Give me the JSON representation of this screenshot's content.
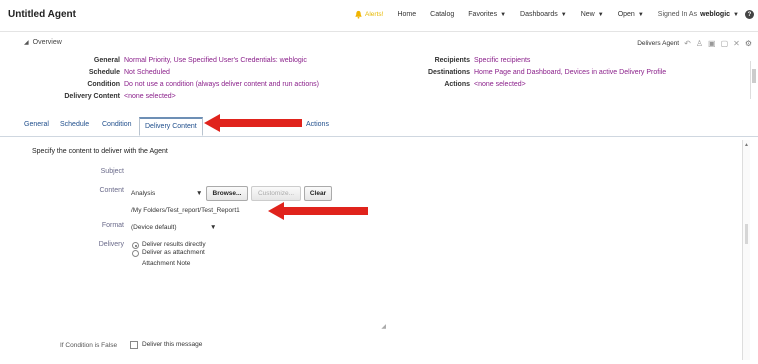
{
  "header": {
    "title": "Untitled Agent",
    "alerts_label": "Alerts!",
    "nav": [
      "Home",
      "Catalog",
      "Favorites",
      "Dashboards",
      "New",
      "Open"
    ],
    "signed_in_label": "Signed In As",
    "user": "weblogic"
  },
  "overview": {
    "heading": "Overview",
    "agent_label": "Delivers Agent",
    "left": [
      {
        "label": "General",
        "value": "Normal Priority, Use Specified User's Credentials: weblogic"
      },
      {
        "label": "Schedule",
        "value": "Not Scheduled"
      },
      {
        "label": "Condition",
        "value": "Do not use a condition (always deliver content and run actions)"
      },
      {
        "label": "Delivery Content",
        "value": "<none selected>"
      }
    ],
    "right": [
      {
        "label": "Recipients",
        "value": "Specific recipients"
      },
      {
        "label": "Destinations",
        "value": "Home Page and Dashboard, Devices in active Delivery Profile"
      },
      {
        "label": "Actions",
        "value": "<none selected>"
      }
    ]
  },
  "tabs": [
    "General",
    "Schedule",
    "Condition",
    "Delivery Content",
    "Actions"
  ],
  "active_tab": "Delivery Content",
  "panel": {
    "description": "Specify the content to deliver with the Agent",
    "subject_label": "Subject",
    "content_label": "Content",
    "content_value": "Analysis",
    "browse_label": "Browse...",
    "customize_label": "Customize...",
    "clear_label": "Clear",
    "path": "/My Folders/Test_report/Test_Report1",
    "format_label": "Format",
    "format_value": "(Device default)",
    "delivery_label": "Delivery",
    "delivery_options": [
      "Deliver results directly",
      "Deliver as attachment"
    ],
    "attachment_note": "Attachment Note",
    "if_false_label": "If Condition is False",
    "deliver_msg_label": "Deliver this message"
  },
  "colors": {
    "link": "#1f4e8c",
    "value": "#8a1f8a",
    "arrow": "#e0231c"
  }
}
